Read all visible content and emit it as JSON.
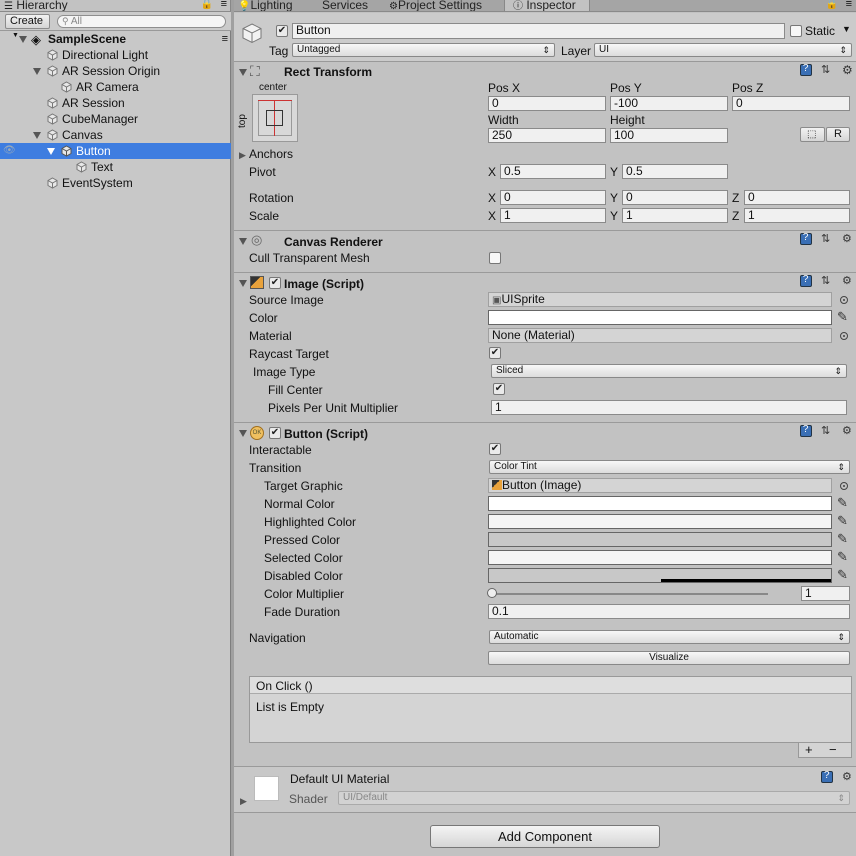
{
  "hierarchy": {
    "tab_label": "Hierarchy",
    "create_label": "Create",
    "search_placeholder": "All",
    "scene_name": "SampleScene",
    "items": [
      {
        "label": "Directional Light"
      },
      {
        "label": "AR Session Origin"
      },
      {
        "label": "AR Camera"
      },
      {
        "label": "AR Session"
      },
      {
        "label": "CubeManager"
      },
      {
        "label": "Canvas"
      },
      {
        "label": "Button"
      },
      {
        "label": "Text"
      },
      {
        "label": "EventSystem"
      }
    ]
  },
  "tabs": [
    {
      "label": "Lighting"
    },
    {
      "label": "Services"
    },
    {
      "label": "Project Settings"
    },
    {
      "label": "Inspector"
    }
  ],
  "object": {
    "name": "Button",
    "static_label": "Static",
    "tag_label": "Tag",
    "tag_value": "Untagged",
    "layer_label": "Layer",
    "layer_value": "UI"
  },
  "rect_transform": {
    "title": "Rect Transform",
    "anchor_h": "center",
    "anchor_v": "top",
    "pos_x_label": "Pos X",
    "pos_x": "0",
    "pos_y_label": "Pos Y",
    "pos_y": "-100",
    "pos_z_label": "Pos Z",
    "pos_z": "0",
    "width_label": "Width",
    "width": "250",
    "height_label": "Height",
    "height": "100",
    "raw_label": "R",
    "anchors_label": "Anchors",
    "pivot_label": "Pivot",
    "pivot_x": "0.5",
    "pivot_y": "0.5",
    "rotation_label": "Rotation",
    "rot_x": "0",
    "rot_y": "0",
    "rot_z": "0",
    "scale_label": "Scale",
    "scale_x": "1",
    "scale_y": "1",
    "scale_z": "1",
    "x": "X",
    "y": "Y",
    "z": "Z"
  },
  "canvas_renderer": {
    "title": "Canvas Renderer",
    "cull_label": "Cull Transparent Mesh"
  },
  "image": {
    "title": "Image (Script)",
    "source_label": "Source Image",
    "source_value": "UISprite",
    "color_label": "Color",
    "material_label": "Material",
    "material_value": "None (Material)",
    "raycast_label": "Raycast Target",
    "type_label": "Image Type",
    "type_value": "Sliced",
    "fill_label": "Fill Center",
    "ppu_label": "Pixels Per Unit Multiplier",
    "ppu_value": "1"
  },
  "button": {
    "title": "Button (Script)",
    "ok_badge": "OK",
    "interactable_label": "Interactable",
    "transition_label": "Transition",
    "transition_value": "Color Tint",
    "target_label": "Target Graphic",
    "target_value": "Button (Image)",
    "normal_label": "Normal Color",
    "highlighted_label": "Highlighted Color",
    "pressed_label": "Pressed Color",
    "selected_label": "Selected Color",
    "disabled_label": "Disabled Color",
    "multiplier_label": "Color Multiplier",
    "multiplier_value": "1",
    "fade_label": "Fade Duration",
    "fade_value": "0.1",
    "navigation_label": "Navigation",
    "navigation_value": "Automatic",
    "visualize_label": "Visualize",
    "onclick_label": "On Click ()",
    "empty_label": "List is Empty",
    "plus": "+",
    "minus": "−"
  },
  "material": {
    "title": "Default UI Material",
    "shader_label": "Shader",
    "shader_value": "UI/Default"
  },
  "add_component_label": "Add Component",
  "colors": {
    "selection": "#3e7de0",
    "pressed": "#c8c8c8",
    "disabled": "#c8c8c8",
    "background": "#c2c2c2"
  }
}
